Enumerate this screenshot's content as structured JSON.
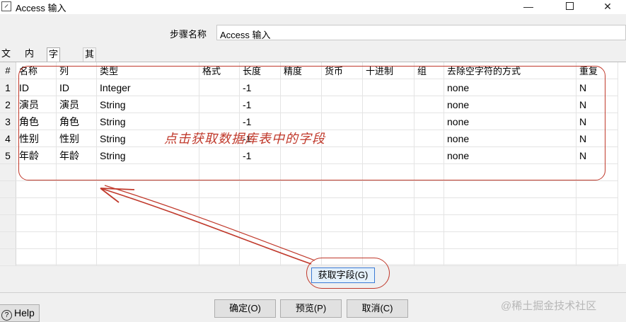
{
  "window": {
    "title": "Access 输入"
  },
  "step": {
    "label": "步骤名称",
    "value": "Access 输入"
  },
  "tabs": [
    {
      "label": "文件"
    },
    {
      "label": "内容"
    },
    {
      "label": "字段"
    },
    {
      "label": "其他输出字段"
    }
  ],
  "grid": {
    "rownum_header": "#",
    "headers": [
      "名称",
      "列",
      "类型",
      "格式",
      "长度",
      "精度",
      "货币",
      "十进制",
      "组",
      "去除空字符的方式",
      "重复"
    ],
    "rows": [
      {
        "num": "1",
        "cells": [
          "ID",
          "ID",
          "Integer",
          "",
          "-1",
          "",
          "",
          "",
          "",
          "none",
          "N"
        ]
      },
      {
        "num": "2",
        "cells": [
          "演员",
          "演员",
          "String",
          "",
          "-1",
          "",
          "",
          "",
          "",
          "none",
          "N"
        ]
      },
      {
        "num": "3",
        "cells": [
          "角色",
          "角色",
          "String",
          "",
          "-1",
          "",
          "",
          "",
          "",
          "none",
          "N"
        ]
      },
      {
        "num": "4",
        "cells": [
          "性别",
          "性别",
          "String",
          "",
          "-1",
          "",
          "",
          "",
          "",
          "none",
          "N"
        ]
      },
      {
        "num": "5",
        "cells": [
          "年龄",
          "年龄",
          "String",
          "",
          "-1",
          "",
          "",
          "",
          "",
          "none",
          "N"
        ]
      }
    ]
  },
  "annotation": {
    "text": "点击获取数据库表中的字段",
    "color": "#c0392b"
  },
  "buttons": {
    "get_fields": "获取字段(G)",
    "ok": "确定(O)",
    "preview": "预览(P)",
    "cancel": "取消(C)",
    "help": "Help"
  },
  "watermark": "@稀土掘金技术社区"
}
